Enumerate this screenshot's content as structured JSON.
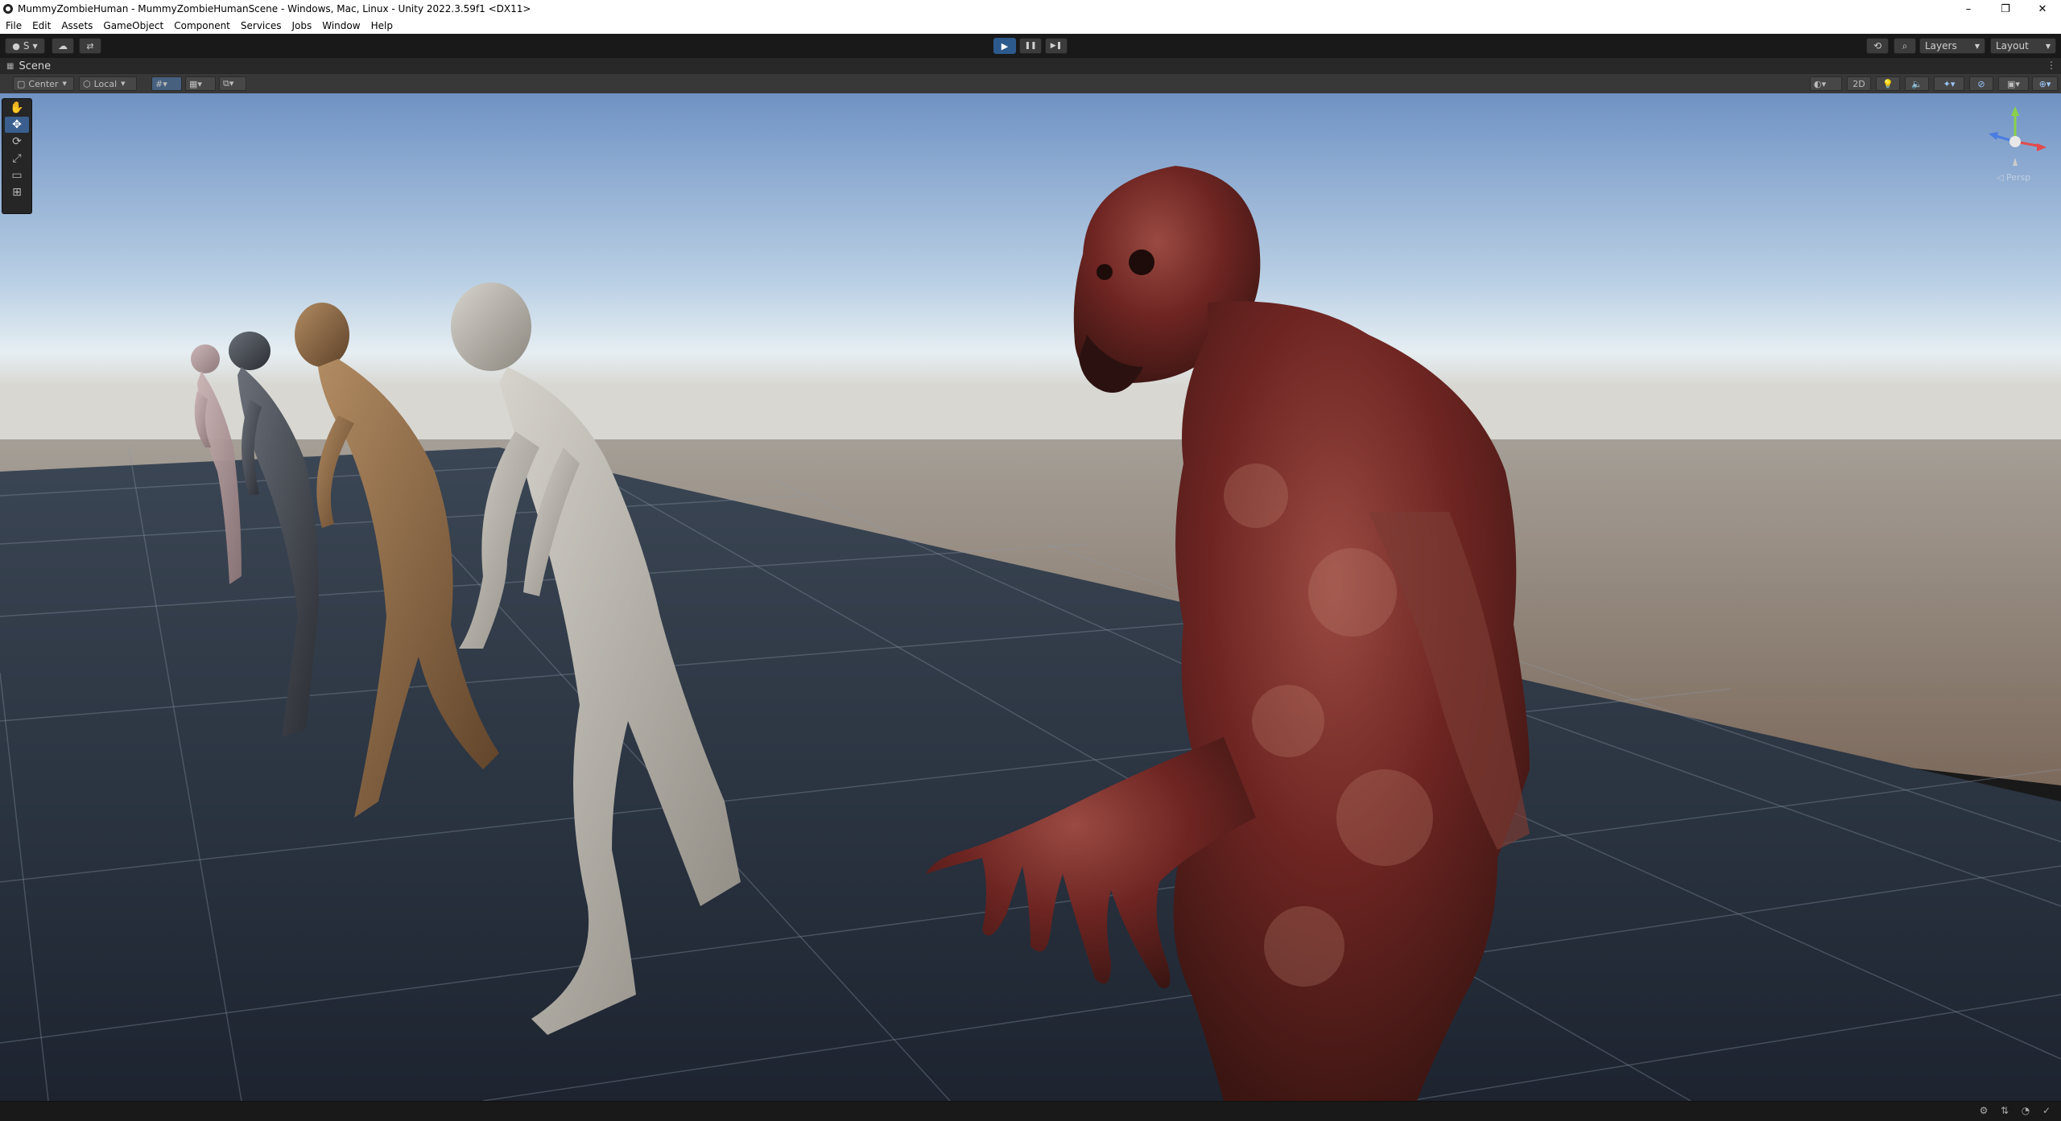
{
  "window": {
    "title": "MummyZombieHuman - MummyZombieHumanScene - Windows, Mac, Linux - Unity 2022.3.59f1 <DX11>",
    "minimize": "–",
    "maximize": "❐",
    "close": "✕"
  },
  "menu": [
    "File",
    "Edit",
    "Assets",
    "GameObject",
    "Component",
    "Services",
    "Jobs",
    "Window",
    "Help"
  ],
  "toolbar": {
    "account_label": "S",
    "play": "▶",
    "pause": "❚❚",
    "step": "▶❚",
    "layers_label": "Layers",
    "layout_label": "Layout"
  },
  "scene_tab": {
    "label": "Scene"
  },
  "scene_toolbar": {
    "pivot_label": "Center",
    "space_label": "Local",
    "mode_2d": "2D"
  },
  "gizmo": {
    "projection_label": "◁ Persp"
  },
  "colors": {
    "play_active": "#2d5a8c",
    "sky_top": "#7d9fcb",
    "ground": "#2b3644",
    "selected_tool": "#3a5f8f"
  },
  "icons": {
    "hand": "hand-icon",
    "move": "move-icon",
    "rotate": "rotate-icon",
    "scale": "scale-icon",
    "rect": "rect-icon",
    "transform": "transform-icon"
  }
}
